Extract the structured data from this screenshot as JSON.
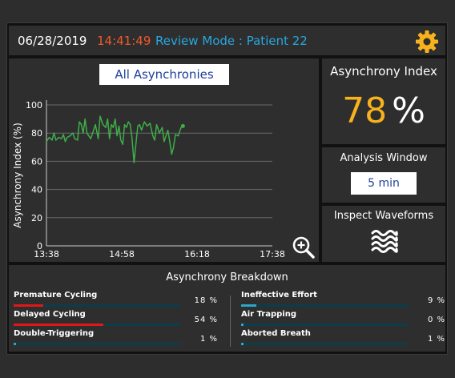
{
  "header": {
    "date": "06/28/2019",
    "time": "14:41:49",
    "mode": "Review Mode : Patient 22",
    "icon": "gear-icon",
    "colors": {
      "time": "#f0592a",
      "mode": "#27a7e0",
      "gear": "#f7b21d"
    }
  },
  "chart_panel": {
    "title": "All Asynchronies",
    "zoom_icon": "zoom-in-icon"
  },
  "chart_data": {
    "type": "line",
    "ylabel": "Asynchrony Index (%)",
    "xlabel": "",
    "ylim": [
      0,
      100
    ],
    "xlim_minutes": [
      0,
      240
    ],
    "yticks": [
      "0",
      "20",
      "40",
      "60",
      "80",
      "100"
    ],
    "xticks": [
      {
        "label": "13:38",
        "minute": 0
      },
      {
        "label": "14:58",
        "minute": 80
      },
      {
        "label": "16:18",
        "minute": 160
      },
      {
        "label": "17:38",
        "minute": 240
      }
    ],
    "grid": true,
    "line_color": "#3fae49",
    "series": [
      {
        "x": [
          0,
          3,
          6,
          8,
          10,
          13,
          16,
          18,
          20,
          22,
          25,
          28,
          30,
          33,
          35,
          37,
          39,
          41,
          43,
          45,
          47,
          50,
          52,
          55,
          57,
          60,
          63,
          65,
          67,
          69,
          71,
          73,
          75,
          77,
          79,
          81,
          83,
          85,
          87,
          89,
          91,
          93,
          95,
          97,
          99,
          101,
          104,
          107,
          110,
          113,
          115,
          117,
          120,
          123,
          125,
          127,
          129,
          131,
          133,
          135,
          137,
          140,
          143,
          145
        ],
        "values": [
          74,
          77,
          75,
          80,
          75,
          77,
          76,
          79,
          74,
          77,
          78,
          80,
          76,
          75,
          88,
          86,
          80,
          90,
          80,
          78,
          76,
          82,
          86,
          76,
          92,
          86,
          84,
          90,
          76,
          86,
          84,
          90,
          78,
          85,
          75,
          72,
          86,
          84,
          88,
          86,
          76,
          59,
          72,
          85,
          86,
          82,
          88,
          85,
          87,
          78,
          75,
          86,
          80,
          84,
          74,
          78,
          82,
          74,
          65,
          70,
          79,
          78,
          84,
          85
        ]
      }
    ]
  },
  "asynchrony_index": {
    "title": "Asynchrony Index",
    "value": "78",
    "unit": "%",
    "value_color": "#f7b21d"
  },
  "analysis_window": {
    "title": "Analysis Window",
    "value": "5 min"
  },
  "inspect_waveforms": {
    "title": "Inspect Waveforms",
    "icon": "waves-icon"
  },
  "breakdown": {
    "title": "Asynchrony Breakdown",
    "items": [
      {
        "label": "Premature Cycling",
        "value": "18 %",
        "percent": 18,
        "color": "#e01818"
      },
      {
        "label": "Delayed Cycling",
        "value": "54 %",
        "percent": 54,
        "color": "#e01818"
      },
      {
        "label": "Double-Triggering",
        "value": "1 %",
        "percent": 1,
        "color": "#2aa7c9"
      },
      {
        "label": "Ineffective Effort",
        "value": "9 %",
        "percent": 9,
        "color": "#2aa7c9"
      },
      {
        "label": "Air Trapping",
        "value": "0 %",
        "percent": 0,
        "color": "#2aa7c9"
      },
      {
        "label": "Aborted Breath",
        "value": "1 %",
        "percent": 1,
        "color": "#2aa7c9"
      }
    ]
  }
}
